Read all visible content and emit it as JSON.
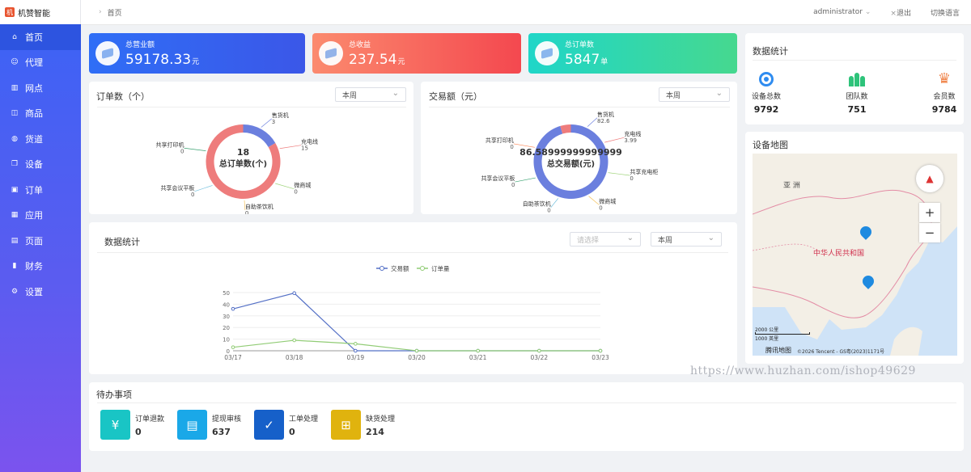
{
  "app": {
    "logo_text": "机赞智能"
  },
  "sidebar": {
    "items": [
      {
        "label": "首页",
        "icon": "home-icon",
        "active": true
      },
      {
        "label": "代理",
        "icon": "user-icon"
      },
      {
        "label": "网点",
        "icon": "building-icon"
      },
      {
        "label": "商品",
        "icon": "bag-icon"
      },
      {
        "label": "货道",
        "icon": "globe-icon"
      },
      {
        "label": "设备",
        "icon": "copy-icon"
      },
      {
        "label": "订单",
        "icon": "doc-icon"
      },
      {
        "label": "应用",
        "icon": "grid-icon"
      },
      {
        "label": "页面",
        "icon": "page-icon"
      },
      {
        "label": "财务",
        "icon": "bars-icon"
      },
      {
        "label": "设置",
        "icon": "gear-icon"
      }
    ]
  },
  "topbar": {
    "breadcrumb": "首页",
    "user": "administrator",
    "logout": "退出",
    "language": "切换语言"
  },
  "stats": [
    {
      "label": "总营业额",
      "value": "59178.33",
      "unit": "元",
      "color_from": "#2f6ef6",
      "color_to": "#3b57e8"
    },
    {
      "label": "总收益",
      "value": "237.54",
      "unit": "元",
      "color_from": "#fb8a6e",
      "color_to": "#f4484f"
    },
    {
      "label": "总订单数",
      "value": "5847",
      "unit": "单",
      "color_from": "#1fd6c8",
      "color_to": "#46d88f"
    }
  ],
  "order_panel": {
    "title": "订单数（个）",
    "select": "本周",
    "center_value": "18",
    "center_label": "总订单数(个)"
  },
  "trade_panel": {
    "title": "交易额（元）",
    "select": "本周",
    "center_value": "86.58999999999999",
    "center_label": "总交易额(元)"
  },
  "line_panel": {
    "title": "数据统计",
    "select_placeholder": "请选择",
    "select": "本周"
  },
  "right_stats": {
    "title": "数据统计",
    "items": [
      {
        "label": "设备总数",
        "value": "9792",
        "icon": "target-icon",
        "color": "#2f8cf0"
      },
      {
        "label": "团队数",
        "value": "751",
        "icon": "team-icon",
        "color": "#2ec37a"
      },
      {
        "label": "会员数",
        "value": "9784",
        "icon": "crown-icon",
        "color": "#f0844a"
      }
    ]
  },
  "map_panel": {
    "title": "设备地图",
    "label_asia": "亚 洲",
    "label_china": "中华人民共和国",
    "scale_km": "2000 公里",
    "scale_mi": "1000 英里",
    "provider": "腾讯地图",
    "copyright": "©2026 Tencent - GS粤(2023)1171号",
    "zoom_in": "+",
    "zoom_out": "−"
  },
  "todo": {
    "title": "待办事项",
    "items": [
      {
        "label": "订单退款",
        "value": "0",
        "color": "#19c5c5",
        "icon": "refund-icon"
      },
      {
        "label": "提现审核",
        "value": "637",
        "color": "#1aa8e8",
        "icon": "withdraw-icon"
      },
      {
        "label": "工单处理",
        "value": "0",
        "color": "#1660c9",
        "icon": "ticket-icon"
      },
      {
        "label": "缺货处理",
        "value": "214",
        "color": "#e0b30e",
        "icon": "restock-icon"
      }
    ]
  },
  "watermark": "https://www.huzhan.com/ishop49629",
  "chart_data": [
    {
      "type": "pie",
      "title": "订单数（个）",
      "center": "18",
      "series": [
        {
          "name": "售货机",
          "value": 3
        },
        {
          "name": "充电线",
          "value": 15
        },
        {
          "name": "微商城",
          "value": 0
        },
        {
          "name": "自助茶饮机",
          "value": 0
        },
        {
          "name": "共享会议平板",
          "value": 0
        },
        {
          "name": "共享打印机",
          "value": 0
        }
      ],
      "colors": [
        "#6b7fde",
        "#ee7c7c",
        "#9fd37a",
        "#f5c25c",
        "#73c0de",
        "#3ba272"
      ]
    },
    {
      "type": "pie",
      "title": "交易额（元）",
      "center": "86.58999999999999",
      "series": [
        {
          "name": "售货机",
          "value": 82.6
        },
        {
          "name": "充电线",
          "value": 3.99
        },
        {
          "name": "共享充电柜",
          "value": 0
        },
        {
          "name": "微商城",
          "value": 0
        },
        {
          "name": "自助茶饮机",
          "value": 0
        },
        {
          "name": "共享会议平板",
          "value": 0
        },
        {
          "name": "共享打印机",
          "value": 0
        }
      ],
      "colors": [
        "#6b7fde",
        "#ee7c7c",
        "#9fd37a",
        "#f5c25c",
        "#73c0de",
        "#3ba272",
        "#fc8452"
      ]
    },
    {
      "type": "line",
      "categories": [
        "03/17",
        "03/18",
        "03/19",
        "03/20",
        "03/21",
        "03/22",
        "03/23"
      ],
      "series": [
        {
          "name": "交易额",
          "values": [
            36,
            49.5,
            0,
            0,
            0,
            0,
            0
          ],
          "color": "#5470c6"
        },
        {
          "name": "订单量",
          "values": [
            3,
            9,
            6,
            0,
            0,
            0,
            0
          ],
          "color": "#91cc75"
        }
      ],
      "ylim": [
        0,
        50
      ],
      "yticks": [
        0,
        10,
        20,
        30,
        40,
        50
      ],
      "legend": "top-center"
    }
  ]
}
